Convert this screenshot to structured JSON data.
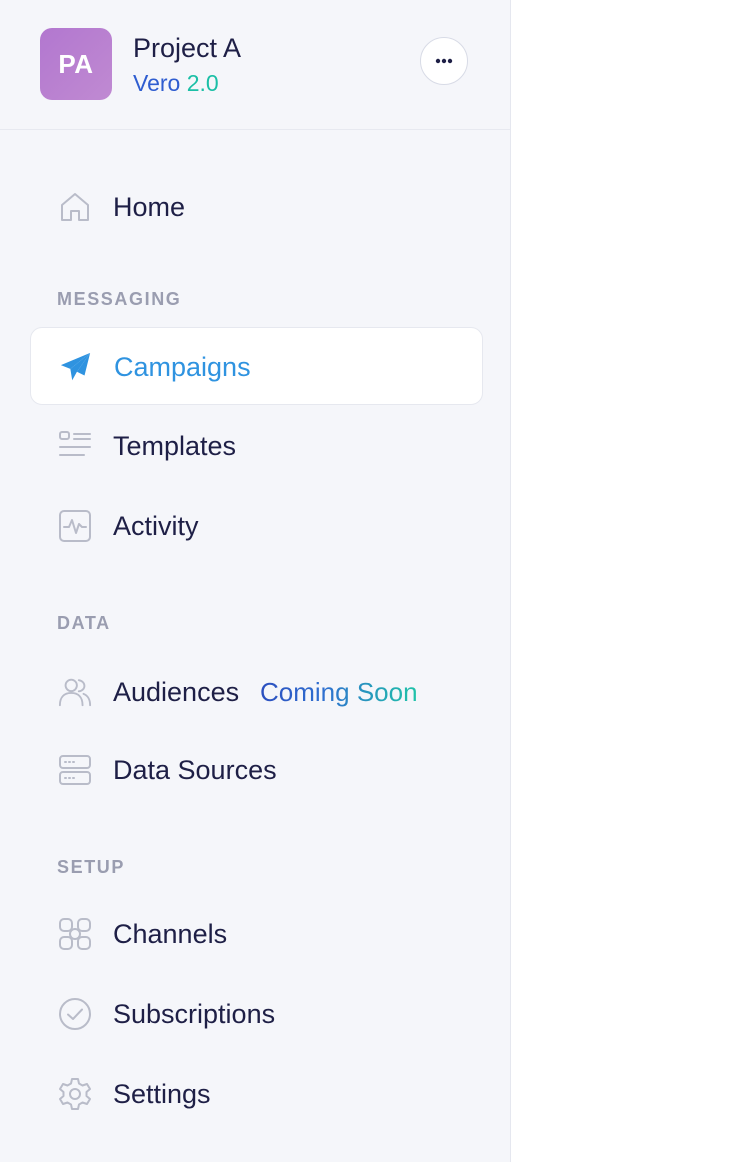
{
  "project": {
    "initials": "PA",
    "name": "Project A",
    "version_name": "Vero",
    "version_number": "2.0",
    "more_icon": "more-horizontal-icon"
  },
  "nav": {
    "home": {
      "label": "Home",
      "icon": "home-icon"
    },
    "sections": {
      "messaging": "MESSAGING",
      "data": "DATA",
      "setup": "SETUP"
    },
    "campaigns": {
      "label": "Campaigns",
      "icon": "paper-plane-icon",
      "active": true
    },
    "templates": {
      "label": "Templates",
      "icon": "template-list-icon"
    },
    "activity": {
      "label": "Activity",
      "icon": "activity-pulse-icon"
    },
    "audiences": {
      "label": "Audiences",
      "icon": "users-icon",
      "badge": "Coming Soon"
    },
    "data_sources": {
      "label": "Data Sources",
      "icon": "server-icon"
    },
    "channels": {
      "label": "Channels",
      "icon": "channels-grid-icon"
    },
    "subscriptions": {
      "label": "Subscriptions",
      "icon": "check-circle-icon"
    },
    "settings": {
      "label": "Settings",
      "icon": "gear-icon"
    }
  },
  "colors": {
    "sidebar_bg": "#f5f6fa",
    "active_accent": "#2f93e0",
    "text_primary": "#1e1f46",
    "section_label": "#9a9db0",
    "avatar": "#b277cf",
    "version_name": "#2f5dd0",
    "version_number": "#1bbfa6"
  }
}
